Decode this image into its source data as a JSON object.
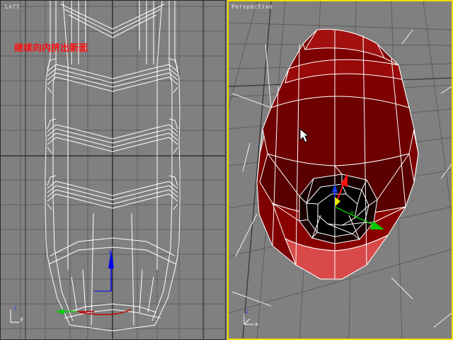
{
  "viewports": {
    "left": {
      "label": "Left",
      "active": false
    },
    "perspective": {
      "label": "Perspective",
      "active": true,
      "border_color": "#f0e000"
    }
  },
  "annotation": {
    "text": "继续向内挤出新面",
    "color": "#ff1010"
  },
  "axis_gizmo": {
    "x": "x",
    "y": "y",
    "z": "z"
  },
  "colors": {
    "viewport_bg": "#808080",
    "grid": "#5f5f5f",
    "grid_major": "#303030",
    "wireframe": "#ffffff",
    "mesh": "#8a0000",
    "gizmo_x": "#00cc00",
    "gizmo_y": "#cc0000",
    "gizmo_z": "#0000ee"
  }
}
